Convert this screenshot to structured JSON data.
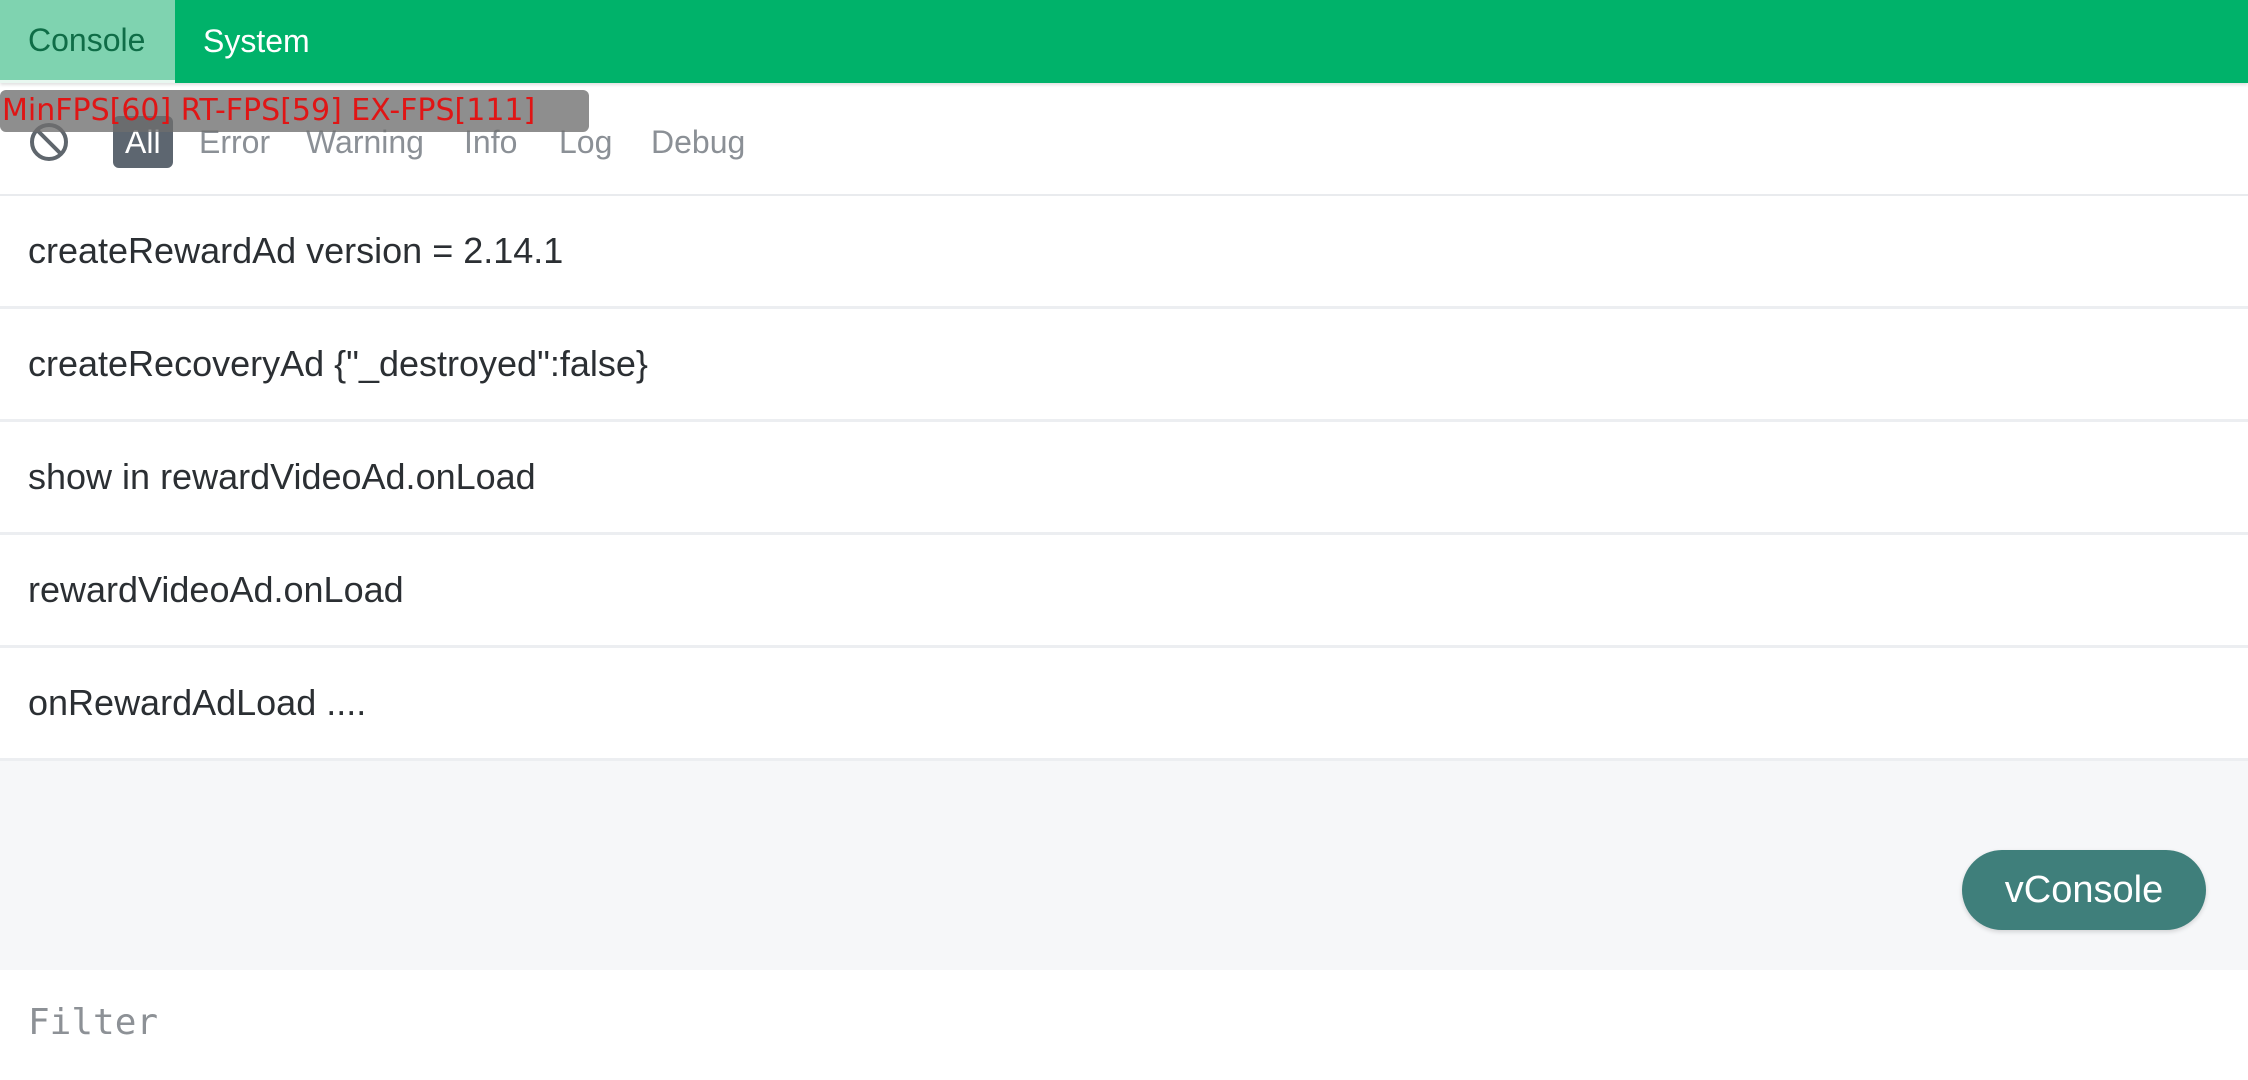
{
  "tabs": [
    {
      "label": "Console",
      "active": true
    },
    {
      "label": "System",
      "active": false
    }
  ],
  "fps_overlay": "MinFPS[60] RT-FPS[59] EX-FPS[111]",
  "levels": [
    {
      "label": "All",
      "active": true
    },
    {
      "label": "Error",
      "active": false
    },
    {
      "label": "Warning",
      "active": false
    },
    {
      "label": "Info",
      "active": false
    },
    {
      "label": "Log",
      "active": false
    },
    {
      "label": "Debug",
      "active": false
    }
  ],
  "logs": [
    "createRewardAd version = 2.14.1",
    "createRecoveryAd {\"_destroyed\":false}",
    "show in rewardVideoAd.onLoad",
    "rewardVideoAd.onLoad",
    "onRewardAdLoad ...."
  ],
  "vconsole_button": "vConsole",
  "filter": {
    "placeholder": "Filter",
    "value": ""
  },
  "colors": {
    "tabbar": "#00b26a",
    "active_tab": "#7fd3b0",
    "vconsole_button": "#3f7f7b",
    "fps_text": "#e01515"
  },
  "icons": {
    "clear": "clear-icon"
  }
}
